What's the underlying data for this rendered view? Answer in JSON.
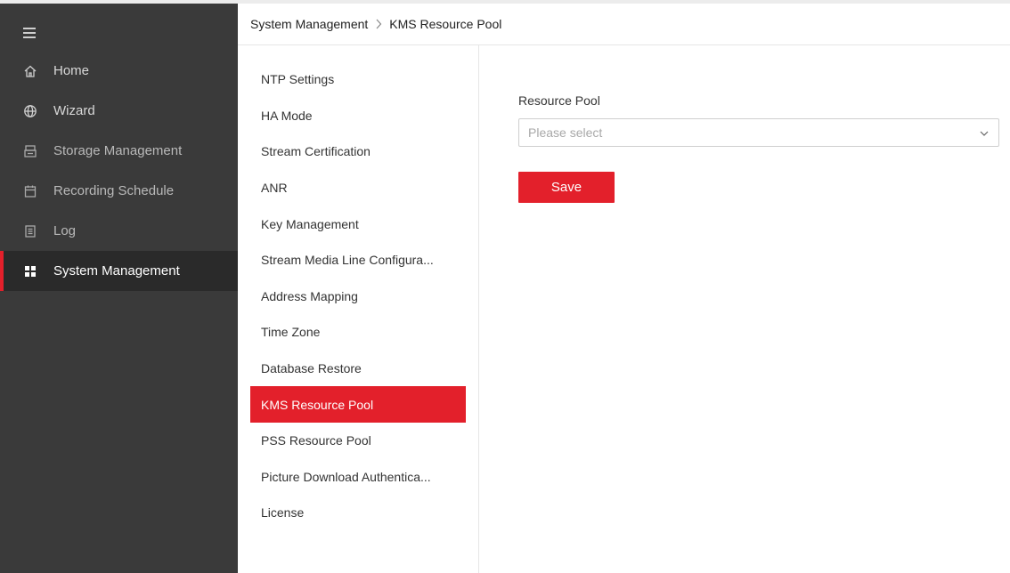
{
  "sidebar": {
    "menu_icon": "hamburger-icon",
    "items": [
      {
        "label": "Home",
        "icon": "home-icon"
      },
      {
        "label": "Wizard",
        "icon": "globe-icon"
      },
      {
        "label": "Storage Management",
        "icon": "storage-icon"
      },
      {
        "label": "Recording Schedule",
        "icon": "calendar-icon"
      },
      {
        "label": "Log",
        "icon": "log-icon"
      },
      {
        "label": "System Management",
        "icon": "grid-icon",
        "active": true
      }
    ]
  },
  "breadcrumb": {
    "parent": "System Management",
    "current": "KMS Resource Pool"
  },
  "submenu": {
    "items": [
      {
        "label": "NTP Settings"
      },
      {
        "label": "HA Mode"
      },
      {
        "label": "Stream Certification"
      },
      {
        "label": "ANR"
      },
      {
        "label": "Key Management"
      },
      {
        "label": "Stream Media Line Configura..."
      },
      {
        "label": "Address Mapping"
      },
      {
        "label": "Time Zone"
      },
      {
        "label": "Database Restore"
      },
      {
        "label": "KMS Resource Pool",
        "active": true
      },
      {
        "label": "PSS Resource Pool"
      },
      {
        "label": "Picture Download Authentica..."
      },
      {
        "label": "License"
      }
    ]
  },
  "form": {
    "resource_pool_label": "Resource Pool",
    "resource_pool_placeholder": "Please select",
    "save_label": "Save"
  },
  "colors": {
    "accent": "#e3202b",
    "sidebar_bg": "#3a3a3a",
    "sidebar_active_bg": "#2a2a2a"
  }
}
